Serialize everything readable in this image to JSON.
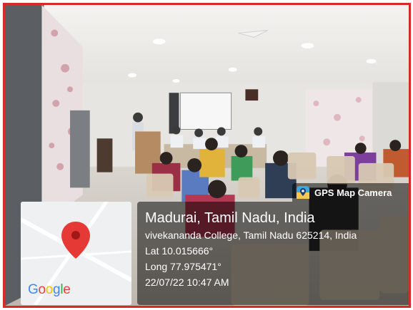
{
  "overlay": {
    "app_name": "GPS Map Camera",
    "place": "Madurai, Tamil Nadu, India",
    "address": "vivekananda College, Tamil Nadu 625214, India",
    "latitude": "Lat 10.015666°",
    "longitude": "Long 77.975471°",
    "datetime": "22/07/22 10:47 AM"
  },
  "map": {
    "logo_text": [
      "G",
      "o",
      "o",
      "g",
      "l",
      "e"
    ],
    "pin_color": "#e53935"
  },
  "frame": {
    "border_color": "#d62a2a"
  },
  "icons": {
    "app": "gps-map-camera-icon",
    "pin": "map-pin-icon"
  }
}
